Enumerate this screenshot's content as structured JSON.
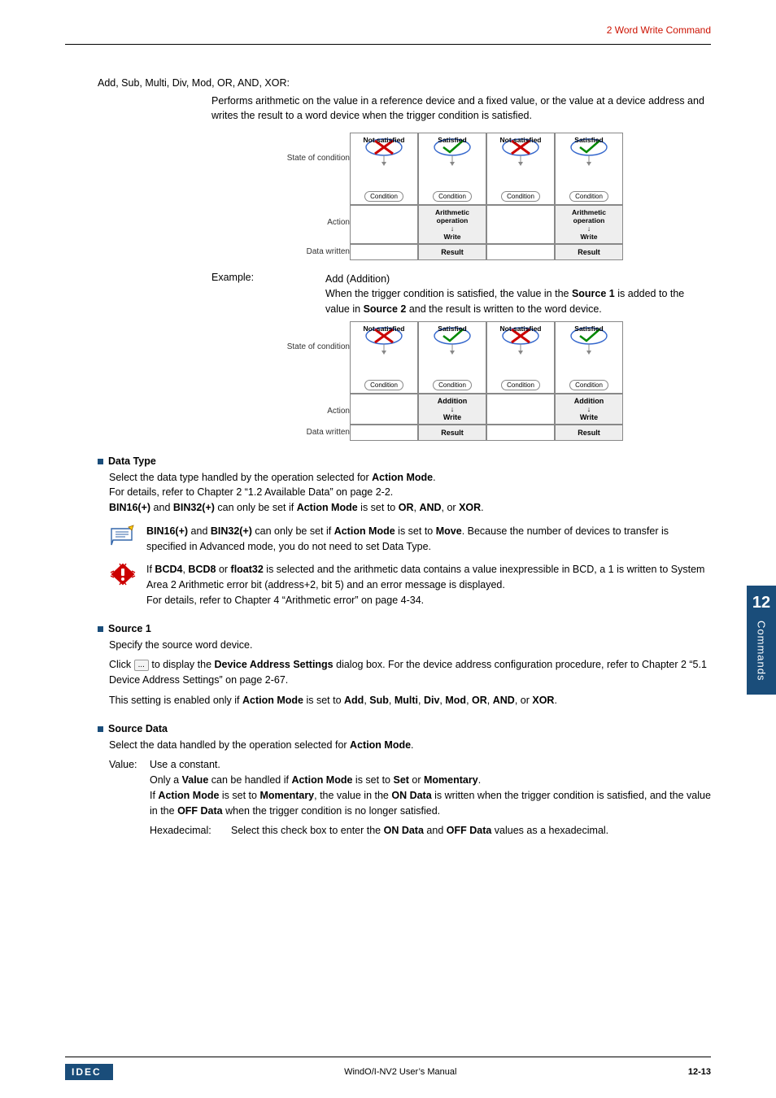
{
  "header": {
    "right": "2 Word Write Command"
  },
  "intro": {
    "title": "Add, Sub, Multi, Div, Mod, OR, AND, XOR:",
    "desc": "Performs arithmetic on the value in a reference device and a fixed value, or the value at a device address and writes the result to a word device when the trigger condition is satisfied."
  },
  "diagram1": {
    "labels": {
      "state": "State of condition",
      "action": "Action",
      "data": "Data written"
    },
    "cells": {
      "ns": "Not satisfied",
      "s": "Satisfied",
      "cond": "Condition",
      "arith": "Arithmetic operation",
      "write": "Write",
      "result": "Result"
    }
  },
  "example": {
    "label": "Example:",
    "title": "Add (Addition)",
    "body_pre": "When the trigger condition is satisfied, the value in the ",
    "s1": "Source 1",
    "body_mid": " is added to the value in ",
    "s2": "Source 2",
    "body_post": " and the result is written to the word device."
  },
  "diagram2": {
    "labels": {
      "state": "State of condition",
      "action": "Action",
      "data": "Data written"
    },
    "cells": {
      "ns": "Not satisfied",
      "s": "Satisfied",
      "cond": "Condition",
      "addition": "Addition",
      "write": "Write",
      "result": "Result"
    }
  },
  "dataType": {
    "head": "Data Type",
    "l1_pre": "Select the data type handled by the operation selected for ",
    "l1_b": "Action Mode",
    "l1_post": ".",
    "l2": "For details, refer to Chapter 2 “1.2 Available Data” on page 2-2.",
    "l3": {
      "b1": "BIN16(+)",
      "t1": " and ",
      "b2": "BIN32(+)",
      "t2": " can only be set if ",
      "b3": "Action Mode",
      "t3": " is set to ",
      "b4": "OR",
      "t4": ", ",
      "b5": "AND",
      "t5": ", or ",
      "b6": "XOR",
      "t6": "."
    }
  },
  "note1": {
    "b1": "BIN16(+)",
    "t1": " and ",
    "b2": "BIN32(+)",
    "t2": " can only be set if ",
    "b3": "Action Mode",
    "t3": " is set to ",
    "b4": "Move",
    "t4": ". Because the number of devices to transfer is specified in Advanced mode, you do not need to set Data Type."
  },
  "note2": {
    "t1": "If ",
    "b1": "BCD4",
    "t2": ", ",
    "b2": "BCD8",
    "t3": " or ",
    "b3": "float32",
    "t4": " is selected and the arithmetic data contains a value inexpressible in BCD, a 1 is written to System Area 2 Arithmetic error bit (address+2, bit 5) and an error message is displayed.",
    "l2": "For details, refer to Chapter 4 “Arithmetic error” on page 4-34."
  },
  "source1": {
    "head": "Source 1",
    "l1": "Specify the source word device.",
    "l2_pre": "Click ",
    "l2_btn": "...",
    "l2_mid": " to display the ",
    "l2_b": "Device Address Settings",
    "l2_post": " dialog box. For the device address configuration procedure, refer to Chapter 2 “5.1 Device Address Settings” on page 2-67.",
    "l3_pre": "This setting is enabled only if ",
    "l3_b1": "Action Mode",
    "l3_t1": " is set to ",
    "l3_b2": "Add",
    "c": ", ",
    "l3_b3": "Sub",
    "l3_b4": "Multi",
    "l3_b5": "Div",
    "l3_b6": "Mod",
    "l3_b7": "OR",
    "l3_b8": "AND",
    "or": ", or ",
    "l3_b9": "XOR",
    "dot": "."
  },
  "sourceData": {
    "head": "Source Data",
    "l1_pre": "Select the data handled by the operation selected for ",
    "l1_b": "Action Mode",
    "l1_post": ".",
    "valueLabel": "Value:",
    "v1": "Use a constant.",
    "v2_pre": "Only a ",
    "v2_b1": "Value",
    "v2_mid": " can be handled if ",
    "v2_b2": "Action Mode",
    "v2_mid2": " is set to ",
    "v2_b3": "Set",
    "v2_or": " or ",
    "v2_b4": "Momentary",
    "v2_post": ".",
    "v3_pre": "If ",
    "v3_b1": "Action Mode",
    "v3_t1": " is set to ",
    "v3_b2": "Momentary",
    "v3_t2": ", the value in the ",
    "v3_b3": "ON Data",
    "v3_t3": " is written when the trigger condition is satisfied, and the value in the ",
    "v3_b4": "OFF Data",
    "v3_t4": " when the trigger condition is no longer satisfied.",
    "hexLabel": "Hexadecimal:",
    "hex_pre": "Select this check box to enter the ",
    "hex_b1": "ON Data",
    "hex_and": " and ",
    "hex_b2": "OFF Data",
    "hex_post": " values as a hexadecimal."
  },
  "sideTab": {
    "num": "12",
    "text": "Commands"
  },
  "footer": {
    "brand": "IDEC",
    "title": "WindO/I-NV2 User’s Manual",
    "page": "12-13"
  }
}
